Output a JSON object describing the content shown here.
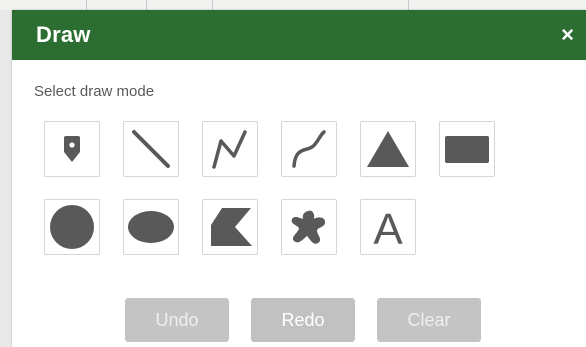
{
  "panel": {
    "title": "Draw",
    "close_glyph": "×",
    "subtitle": "Select draw mode"
  },
  "tools_row1": [
    {
      "name": "point",
      "icon": "map-pin-icon"
    },
    {
      "name": "line",
      "icon": "straight-line-icon"
    },
    {
      "name": "polyline",
      "icon": "polyline-icon"
    },
    {
      "name": "freehand-line",
      "icon": "freehand-line-icon"
    },
    {
      "name": "triangle",
      "icon": "triangle-icon"
    },
    {
      "name": "rectangle",
      "icon": "rectangle-icon"
    }
  ],
  "tools_row2": [
    {
      "name": "circle",
      "icon": "circle-icon"
    },
    {
      "name": "ellipse",
      "icon": "ellipse-icon"
    },
    {
      "name": "polygon",
      "icon": "polygon-icon"
    },
    {
      "name": "freehand-polygon",
      "icon": "freehand-polygon-icon"
    },
    {
      "name": "text",
      "icon": "text-icon",
      "glyph": "A"
    }
  ],
  "buttons": {
    "undo": "Undo",
    "redo": "Redo",
    "clear": "Clear"
  },
  "colors": {
    "header": "#2c6e31",
    "icon": "#595959",
    "button_disabled": "#c4c4c4"
  }
}
